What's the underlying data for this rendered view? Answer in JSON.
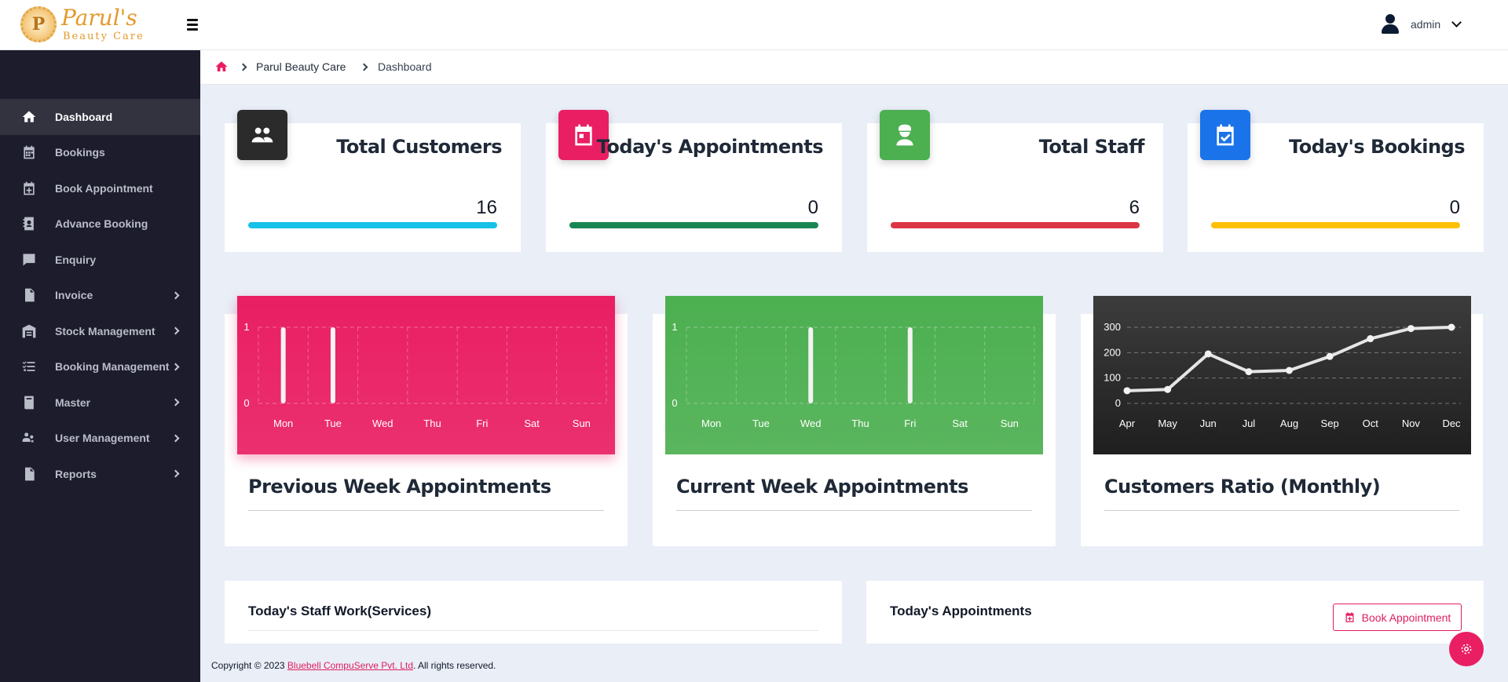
{
  "brand": {
    "logo_letter": "P",
    "name": "Parul's",
    "tagline": "Beauty Care"
  },
  "user": {
    "name": "admin"
  },
  "sidebar": {
    "items": [
      {
        "label": "Dashboard",
        "icon": "home-icon",
        "active": true
      },
      {
        "label": "Bookings",
        "icon": "calendar-grid-icon"
      },
      {
        "label": "Book Appointment",
        "icon": "calendar-plus-icon"
      },
      {
        "label": "Advance Booking",
        "icon": "contact-book-icon"
      },
      {
        "label": "Enquiry",
        "icon": "chat-bubble-icon"
      },
      {
        "label": "Invoice",
        "icon": "invoice-icon",
        "expandable": true
      },
      {
        "label": "Stock Management",
        "icon": "warehouse-icon",
        "expandable": true
      },
      {
        "label": "Booking Management",
        "icon": "list-check-icon",
        "expandable": true
      },
      {
        "label": "Master",
        "icon": "book-icon",
        "expandable": true
      },
      {
        "label": "User Management",
        "icon": "users-gear-icon",
        "expandable": true
      },
      {
        "label": "Reports",
        "icon": "report-file-icon",
        "expandable": true
      }
    ]
  },
  "breadcrumb": {
    "items": [
      "Parul Beauty Care",
      "Dashboard"
    ]
  },
  "stats": [
    {
      "title": "Total Customers",
      "value": "16",
      "icon": "users-icon",
      "badge_color": "#2b2b2b",
      "bar_color": "#17c1e8"
    },
    {
      "title": "Today's Appointments",
      "value": "0",
      "icon": "calendar-icon",
      "badge_color": "#e91e63",
      "bar_color": "#198754"
    },
    {
      "title": "Total Staff",
      "value": "6",
      "icon": "staff-icon",
      "badge_color": "#4caf50",
      "bar_color": "#dc3545"
    },
    {
      "title": "Today's Bookings",
      "value": "0",
      "icon": "calendar-check-icon",
      "badge_color": "#1a73e8",
      "bar_color": "#ffc107"
    }
  ],
  "charts": {
    "titles": [
      "Previous Week Appointments",
      "Current Week Appointments",
      "Customers Ratio (Monthly)"
    ]
  },
  "chart_data": [
    {
      "type": "bar",
      "categories": [
        "Mon",
        "Tue",
        "Wed",
        "Thu",
        "Fri",
        "Sat",
        "Sun"
      ],
      "values": [
        1,
        1,
        0,
        0,
        0,
        0,
        0
      ],
      "title": "Previous Week Appointments",
      "yticks": [
        0,
        1
      ],
      "ylim": [
        0,
        1
      ],
      "grid": true,
      "background": "#e91e63"
    },
    {
      "type": "bar",
      "categories": [
        "Mon",
        "Tue",
        "Wed",
        "Thu",
        "Fri",
        "Sat",
        "Sun"
      ],
      "values": [
        0,
        0,
        1,
        0,
        1,
        0,
        0
      ],
      "title": "Current Week Appointments",
      "yticks": [
        0,
        1
      ],
      "ylim": [
        0,
        1
      ],
      "grid": true,
      "background": "#4caf50"
    },
    {
      "type": "line",
      "categories": [
        "Apr",
        "May",
        "Jun",
        "Jul",
        "Aug",
        "Sep",
        "Oct",
        "Nov",
        "Dec"
      ],
      "values": [
        50,
        55,
        195,
        125,
        130,
        185,
        255,
        295,
        300
      ],
      "title": "Customers Ratio (Monthly)",
      "yticks": [
        0,
        100,
        200,
        300
      ],
      "ylim": [
        0,
        300
      ],
      "grid": true,
      "background": "#2b2b2b"
    }
  ],
  "panels": {
    "staff_title": "Today's Staff Work(Services)",
    "appointments_title": "Today's Appointments",
    "book_button": "Book Appointment"
  },
  "footer": {
    "prefix": "Copyright © 2023 ",
    "company": "Bluebell CompuServe Pvt. Ltd",
    "suffix": ". All rights reserved."
  }
}
